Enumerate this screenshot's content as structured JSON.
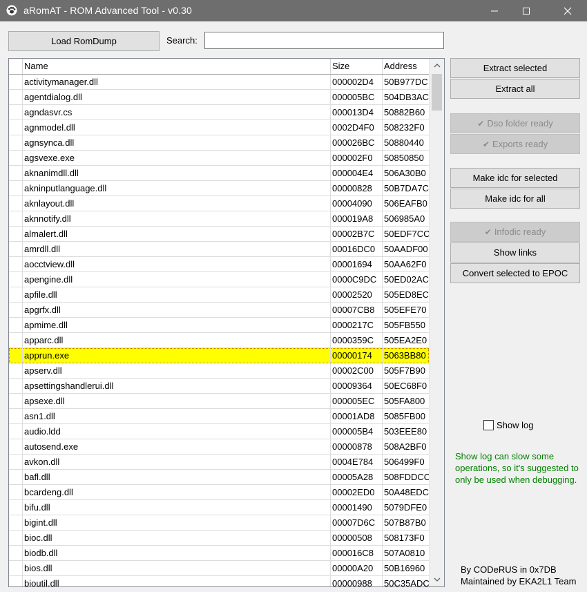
{
  "window": {
    "title": "aRomAT - ROM Advanced Tool - v0.30",
    "app_icon": "paw-icon",
    "minimize_glyph": "─",
    "maximize_glyph": "☐",
    "close_glyph": "✕"
  },
  "toolbar": {
    "load_label": "Load RomDump",
    "search_label": "Search:",
    "search_value": "",
    "search_placeholder": ""
  },
  "table": {
    "columns": [
      "Name",
      "Size",
      "Address"
    ],
    "rows": [
      {
        "name": "activitymanager.dll",
        "size": "000002D4",
        "address": "50B977DC"
      },
      {
        "name": "agentdialog.dll",
        "size": "000005BC",
        "address": "504DB3AC"
      },
      {
        "name": "agndasvr.cs",
        "size": "000013D4",
        "address": "50882B60"
      },
      {
        "name": "agnmodel.dll",
        "size": "0002D4F0",
        "address": "508232F0"
      },
      {
        "name": "agnsynca.dll",
        "size": "000026BC",
        "address": "50880440"
      },
      {
        "name": "agsvexe.exe",
        "size": "000002F0",
        "address": "50850850"
      },
      {
        "name": "aknanimdll.dll",
        "size": "000004E4",
        "address": "506A30B0"
      },
      {
        "name": "akninputlanguage.dll",
        "size": "00000828",
        "address": "50B7DA7C"
      },
      {
        "name": "aknlayout.dll",
        "size": "00004090",
        "address": "506EAFB0"
      },
      {
        "name": "aknnotify.dll",
        "size": "000019A8",
        "address": "506985A0"
      },
      {
        "name": "almalert.dll",
        "size": "00002B7C",
        "address": "50EDF7CC"
      },
      {
        "name": "amrdll.dll",
        "size": "00016DC0",
        "address": "50AADF00"
      },
      {
        "name": "aocctview.dll",
        "size": "00001694",
        "address": "50AA62F0"
      },
      {
        "name": "apengine.dll",
        "size": "0000C9DC",
        "address": "50ED02AC"
      },
      {
        "name": "apfile.dll",
        "size": "00002520",
        "address": "505ED8EC"
      },
      {
        "name": "apgrfx.dll",
        "size": "00007CB8",
        "address": "505EFE70"
      },
      {
        "name": "apmime.dll",
        "size": "0000217C",
        "address": "505FB550"
      },
      {
        "name": "apparc.dll",
        "size": "0000359C",
        "address": "505EA2E0"
      },
      {
        "name": "apprun.exe",
        "size": "00000174",
        "address": "5063BB80"
      },
      {
        "name": "apserv.dll",
        "size": "00002C00",
        "address": "505F7B90"
      },
      {
        "name": "apsettingshandlerui.dll",
        "size": "00009364",
        "address": "50EC68F0"
      },
      {
        "name": "apsexe.dll",
        "size": "000005EC",
        "address": "505FA800"
      },
      {
        "name": "asn1.dll",
        "size": "00001AD8",
        "address": "5085FB00"
      },
      {
        "name": "audio.ldd",
        "size": "000005B4",
        "address": "503EEE80"
      },
      {
        "name": "autosend.exe",
        "size": "00000878",
        "address": "508A2BF0"
      },
      {
        "name": "avkon.dll",
        "size": "0004E784",
        "address": "506499F0"
      },
      {
        "name": "bafl.dll",
        "size": "00005A28",
        "address": "508FDDCC"
      },
      {
        "name": "bcardeng.dll",
        "size": "00002ED0",
        "address": "50A48EDC"
      },
      {
        "name": "bifu.dll",
        "size": "00001490",
        "address": "5079DFE0"
      },
      {
        "name": "bigint.dll",
        "size": "00007D6C",
        "address": "507B87B0"
      },
      {
        "name": "bioc.dll",
        "size": "00000508",
        "address": "508173F0"
      },
      {
        "name": "biodb.dll",
        "size": "000016C8",
        "address": "507A0810"
      },
      {
        "name": "bios.dll",
        "size": "00000A20",
        "address": "50B16960"
      },
      {
        "name": "bioutil.dll",
        "size": "00000988",
        "address": "50C35ADC"
      }
    ]
  },
  "actions": {
    "extract_selected": "Extract selected",
    "extract_all": "Extract all",
    "dso_ready": "Dso folder ready",
    "exports_ready": "Exports ready",
    "make_idc_selected": "Make idc for selected",
    "make_idc_all": "Make idc for all",
    "infodic_ready": "Infodic ready",
    "show_links": "Show links",
    "convert_epoc": "Convert selected to EPOC",
    "check_glyph": "✔"
  },
  "log": {
    "show_log_label": "Show log",
    "show_log_checked": false,
    "note": "Show log can slow some operations, so it's suggested to only be used when debugging."
  },
  "credits": {
    "line1": "By CODeRUS in 0x7DB",
    "line2": "Maintained by EKA2L1 Team"
  },
  "colors": {
    "selected_row": "#ffff00",
    "note_text": "#008000",
    "titlebar": "#6e6e6e"
  },
  "selected_row_index": 18
}
